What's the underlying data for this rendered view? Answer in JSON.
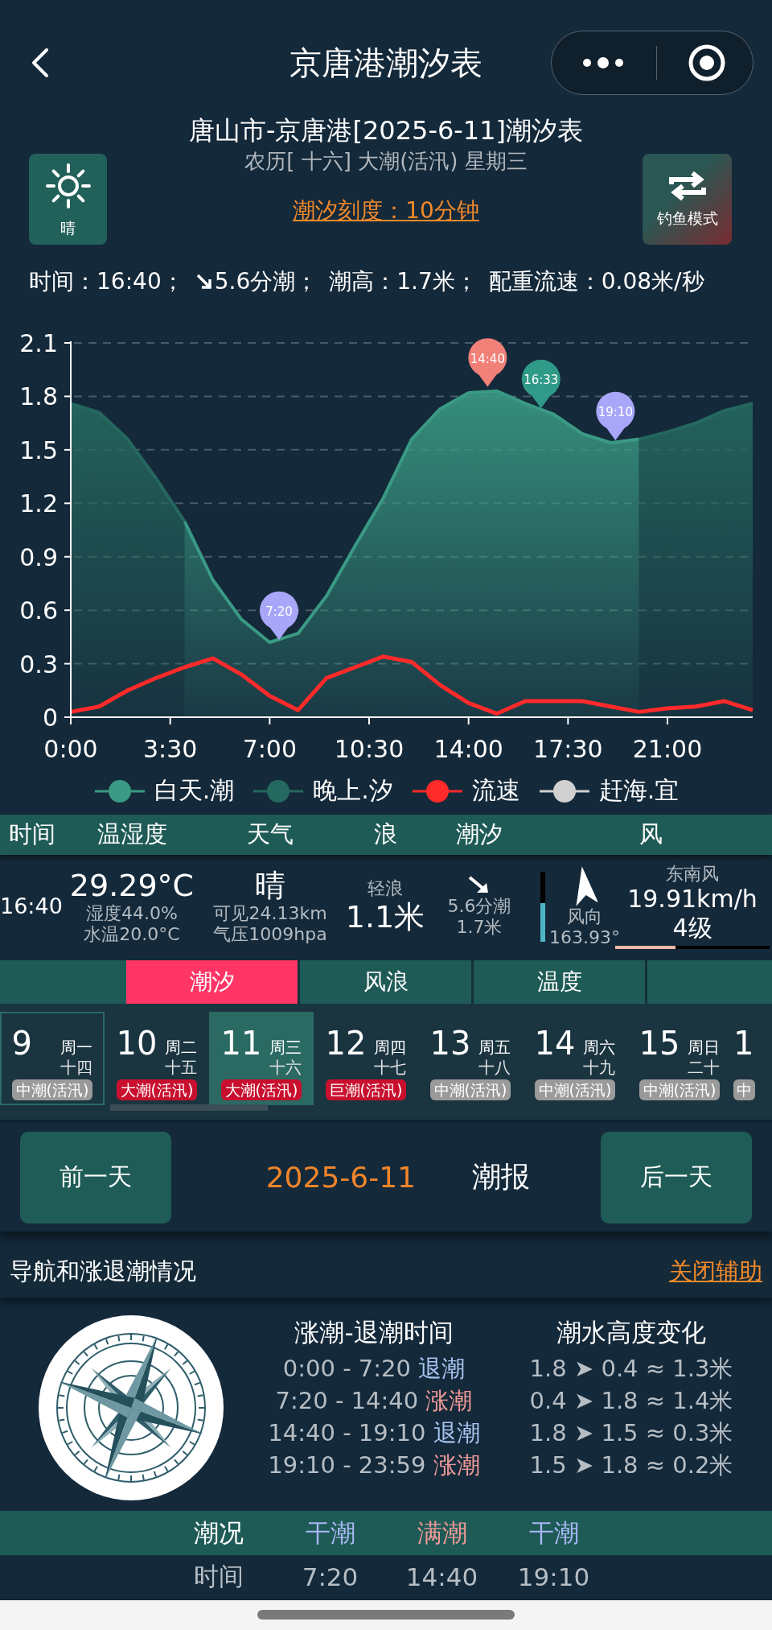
{
  "nav_bar": {
    "title": "京唐港潮汐表"
  },
  "header": {
    "location_title": "唐山市-京唐港[2025-6-11]潮汐表",
    "lunar_line": "农历[ 十六] 大潮(活汛) 星期三",
    "scale_link": "潮汐刻度：10分钟",
    "weather_button": "晴",
    "mode_button": "钓鱼模式"
  },
  "status_line": {
    "time": "时间：16:40；",
    "tide": "5.6分潮；",
    "height": "潮高：1.7米；",
    "flow": "配重流速：0.08米/秒"
  },
  "chart": {
    "chart_data": {
      "type": "area",
      "grid": true,
      "x": [
        0,
        1,
        2,
        3,
        4,
        5,
        6,
        7,
        8,
        9,
        10,
        11,
        12,
        13,
        14,
        15,
        16,
        17,
        18,
        19,
        20,
        21,
        22,
        23,
        24
      ],
      "xlim": [
        0,
        24
      ],
      "ylim": [
        0,
        2.1
      ],
      "xticks": [
        {
          "value": 0,
          "label": "0:00"
        },
        {
          "value": 3.5,
          "label": "3:30"
        },
        {
          "value": 7,
          "label": "7:00"
        },
        {
          "value": 10.5,
          "label": "10:30"
        },
        {
          "value": 14,
          "label": "14:00"
        },
        {
          "value": 17.5,
          "label": "17:30"
        },
        {
          "value": 21,
          "label": "21:00"
        }
      ],
      "yticks": [
        0,
        0.3,
        0.6,
        0.9,
        1.2,
        1.5,
        1.8,
        2.1
      ],
      "series": [
        {
          "name": "白天.潮",
          "color": "#3a9a84",
          "values": [
            null,
            null,
            null,
            null,
            1.1,
            0.77,
            0.55,
            0.42,
            0.47,
            0.68,
            0.96,
            1.23,
            1.56,
            1.73,
            1.82,
            1.83,
            1.76,
            1.7,
            1.59,
            1.54,
            1.56,
            null,
            null,
            null,
            null
          ]
        },
        {
          "name": "晚上.汐",
          "color": "#25685f",
          "values": [
            1.76,
            1.71,
            1.56,
            1.34,
            1.1,
            null,
            null,
            null,
            null,
            null,
            null,
            null,
            null,
            null,
            null,
            null,
            null,
            null,
            null,
            null,
            1.56,
            1.6,
            1.65,
            1.72,
            1.76
          ]
        },
        {
          "name": "流速",
          "type": "line",
          "color": "#ff2a2a",
          "values": [
            0.03,
            0.06,
            0.15,
            0.22,
            0.28,
            0.33,
            0.24,
            0.12,
            0.04,
            0.22,
            0.28,
            0.34,
            0.31,
            0.18,
            0.08,
            0.02,
            0.09,
            0.09,
            0.09,
            0.06,
            0.03,
            0.05,
            0.06,
            0.09,
            0.04
          ]
        },
        {
          "name": "赶海.宜",
          "color": "#d0d0d0",
          "values": [
            null,
            null,
            null,
            null,
            null,
            null,
            null,
            null,
            null,
            null,
            null,
            null,
            null,
            null,
            null,
            null,
            null,
            null,
            null,
            null,
            null,
            null,
            null,
            null,
            null
          ]
        }
      ],
      "annotations": [
        {
          "x": 7.33,
          "y": 0.42,
          "text": "7:20"
        },
        {
          "x": 14.67,
          "y": 1.84,
          "text": "14:40"
        },
        {
          "x": 16.55,
          "y": 1.72,
          "text": "16:33"
        },
        {
          "x": 19.17,
          "y": 1.54,
          "text": "19:10"
        }
      ]
    }
  },
  "conditions": {
    "columns": [
      "时间",
      "温湿度",
      "天气",
      "浪",
      "潮汐",
      "风"
    ],
    "time": "16:40",
    "temperature": "29.29°C",
    "humidity": "湿度44.0%",
    "water_temp": "水温20.0°C",
    "weather": "晴",
    "visibility": "可见24.13km",
    "pressure": "气压1009hpa",
    "wave_name": "轻浪",
    "wave_height": "1.1米",
    "tide_state": "5.6分潮",
    "tide_height": "1.7米",
    "tide_gauge": {
      "level": 0.55
    },
    "wind_label": "风向",
    "wind_degrees": "163.93°",
    "wind_name": "东南风",
    "wind_speed": "19.91km/h",
    "wind_grade": "4级",
    "wind_gauge": {
      "level": 0.39
    }
  },
  "tabs": [
    {
      "label": "潮汐",
      "selected": true
    },
    {
      "label": "风浪",
      "selected": false
    },
    {
      "label": "温度",
      "selected": false
    }
  ],
  "days": [
    {
      "date": "9",
      "weekday": "周一",
      "lunar": "十四",
      "badge": "中潮(活汛)",
      "color": "#9a9a9a",
      "today": true,
      "selected": false
    },
    {
      "date": "10",
      "weekday": "周二",
      "lunar": "十五",
      "badge": "大潮(活汛)",
      "color": "#c8102e",
      "today": false,
      "selected": false
    },
    {
      "date": "11",
      "weekday": "周三",
      "lunar": "十六",
      "badge": "大潮(活汛)",
      "color": "#c8102e",
      "today": false,
      "selected": true
    },
    {
      "date": "12",
      "weekday": "周四",
      "lunar": "十七",
      "badge": "巨潮(活汛)",
      "color": "#c8102e",
      "today": false,
      "selected": false
    },
    {
      "date": "13",
      "weekday": "周五",
      "lunar": "十八",
      "badge": "中潮(活汛)",
      "color": "#9a9a9a",
      "today": false,
      "selected": false
    },
    {
      "date": "14",
      "weekday": "周六",
      "lunar": "十九",
      "badge": "中潮(活汛)",
      "color": "#9a9a9a",
      "today": false,
      "selected": false
    },
    {
      "date": "15",
      "weekday": "周日",
      "lunar": "二十",
      "badge": "中潮(活汛)",
      "color": "#9a9a9a",
      "today": false,
      "selected": false
    },
    {
      "date": "1",
      "badge": "中",
      "color": "#9a9a9a",
      "today": false,
      "selected": false
    }
  ],
  "date_nav": {
    "prev": "前一天",
    "date": "2025-6-11",
    "report": "潮报",
    "next": "后一天"
  },
  "section": {
    "title": "导航和涨退潮情况",
    "link": "关闭辅助"
  },
  "tide_periods": {
    "columns": [
      "涨潮-退潮时间",
      "潮水高度变化"
    ],
    "rows": [
      {
        "range": "0:00 - 7:20",
        "state": "退潮",
        "kind": "ebb",
        "change": "1.8 ➤ 0.4 ≈ 1.3米"
      },
      {
        "range": "7:20 - 14:40",
        "state": "涨潮",
        "kind": "flood",
        "change": "0.4 ➤ 1.8 ≈ 1.4米"
      },
      {
        "range": "14:40 - 19:10",
        "state": "退潮",
        "kind": "ebb",
        "change": "1.8 ➤ 1.5 ≈ 0.3米"
      },
      {
        "range": "19:10 - 23:59",
        "state": "涨潮",
        "kind": "flood",
        "change": "1.5 ➤ 1.8 ≈ 0.2米"
      }
    ]
  },
  "tide_table": {
    "header": [
      {
        "label": "潮况",
        "kind": "label"
      },
      {
        "label": "干潮",
        "kind": "low"
      },
      {
        "label": "满潮",
        "kind": "high"
      },
      {
        "label": "干潮",
        "kind": "low"
      }
    ],
    "rows": [
      [
        "时间",
        "7:20",
        "14:40",
        "19:10"
      ]
    ]
  }
}
